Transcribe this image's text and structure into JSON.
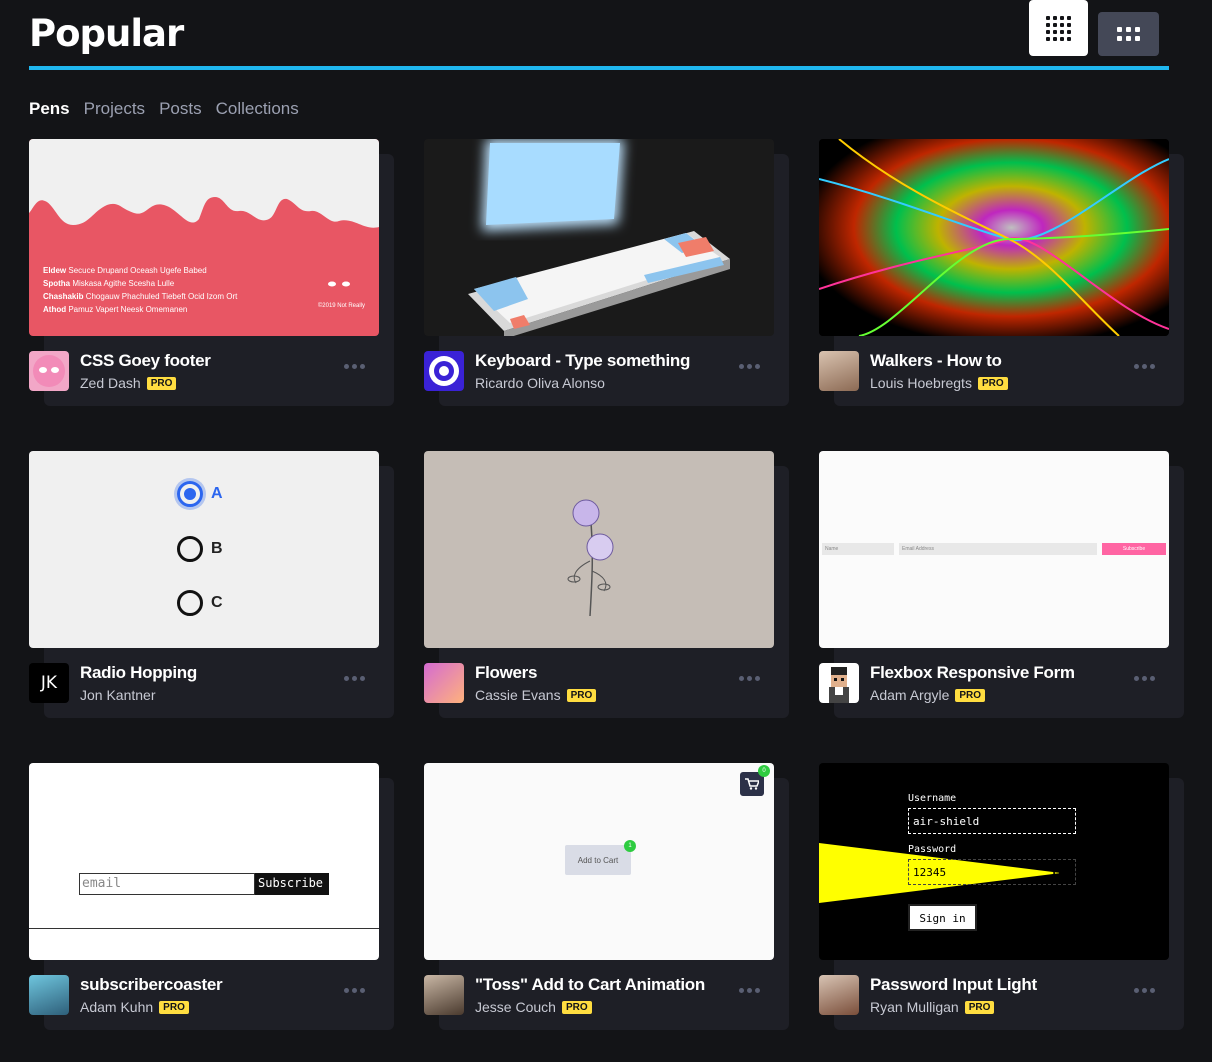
{
  "page": {
    "title": "Popular"
  },
  "tabs": [
    "Pens",
    "Projects",
    "Posts",
    "Collections"
  ],
  "active_tab": "Pens",
  "colors": {
    "accent": "#1fb7ef",
    "pro_badge": "#ffdd40",
    "bg": "#131417",
    "card": "#1e1f26"
  },
  "cards": [
    {
      "title": "CSS Goey footer",
      "author": "Zed Dash",
      "pro": "PRO",
      "thumb": {
        "lines": [
          [
            "Eldew",
            "Secuce Drupand Oceash Ugefe Babed"
          ],
          [
            "Spotha",
            "Miskasa Agithe Scesha Lulle"
          ],
          [
            "Chashakib",
            "Chogauw Phachuled Tiebeft Ocid Izom Ort"
          ],
          [
            "Athod",
            "Pamuz Vapert Neesk Omemanen"
          ]
        ],
        "copyright": "©2019 Not Really"
      }
    },
    {
      "title": "Keyboard - Type something",
      "author": "Ricardo Oliva Alonso",
      "pro": ""
    },
    {
      "title": "Walkers - How to",
      "author": "Louis Hoebregts",
      "pro": "PRO"
    },
    {
      "title": "Radio Hopping",
      "author": "Jon Kantner",
      "pro": "",
      "thumb": {
        "options": [
          "A",
          "B",
          "C"
        ],
        "selected": "A"
      },
      "avatar_text": "JK"
    },
    {
      "title": "Flowers",
      "author": "Cassie Evans",
      "pro": "PRO"
    },
    {
      "title": "Flexbox Responsive Form",
      "author": "Adam Argyle",
      "pro": "PRO",
      "thumb": {
        "name": "Name",
        "email": "Email Address",
        "button": "Subscribe"
      }
    },
    {
      "title": "subscribercoaster",
      "author": "Adam Kuhn",
      "pro": "PRO",
      "thumb": {
        "placeholder": "email",
        "button": "Subscribe"
      }
    },
    {
      "title": "\"Toss\" Add to Cart Animation",
      "author": "Jesse Couch",
      "pro": "PRO",
      "thumb": {
        "button": "Add to Cart",
        "badge": "1",
        "cart_badge": "0"
      }
    },
    {
      "title": "Password Input Light",
      "author": "Ryan Mulligan",
      "pro": "PRO",
      "thumb": {
        "username_label": "Username",
        "username": "air-shield",
        "password_label": "Password",
        "password": "12345",
        "button": "Sign in"
      }
    }
  ]
}
